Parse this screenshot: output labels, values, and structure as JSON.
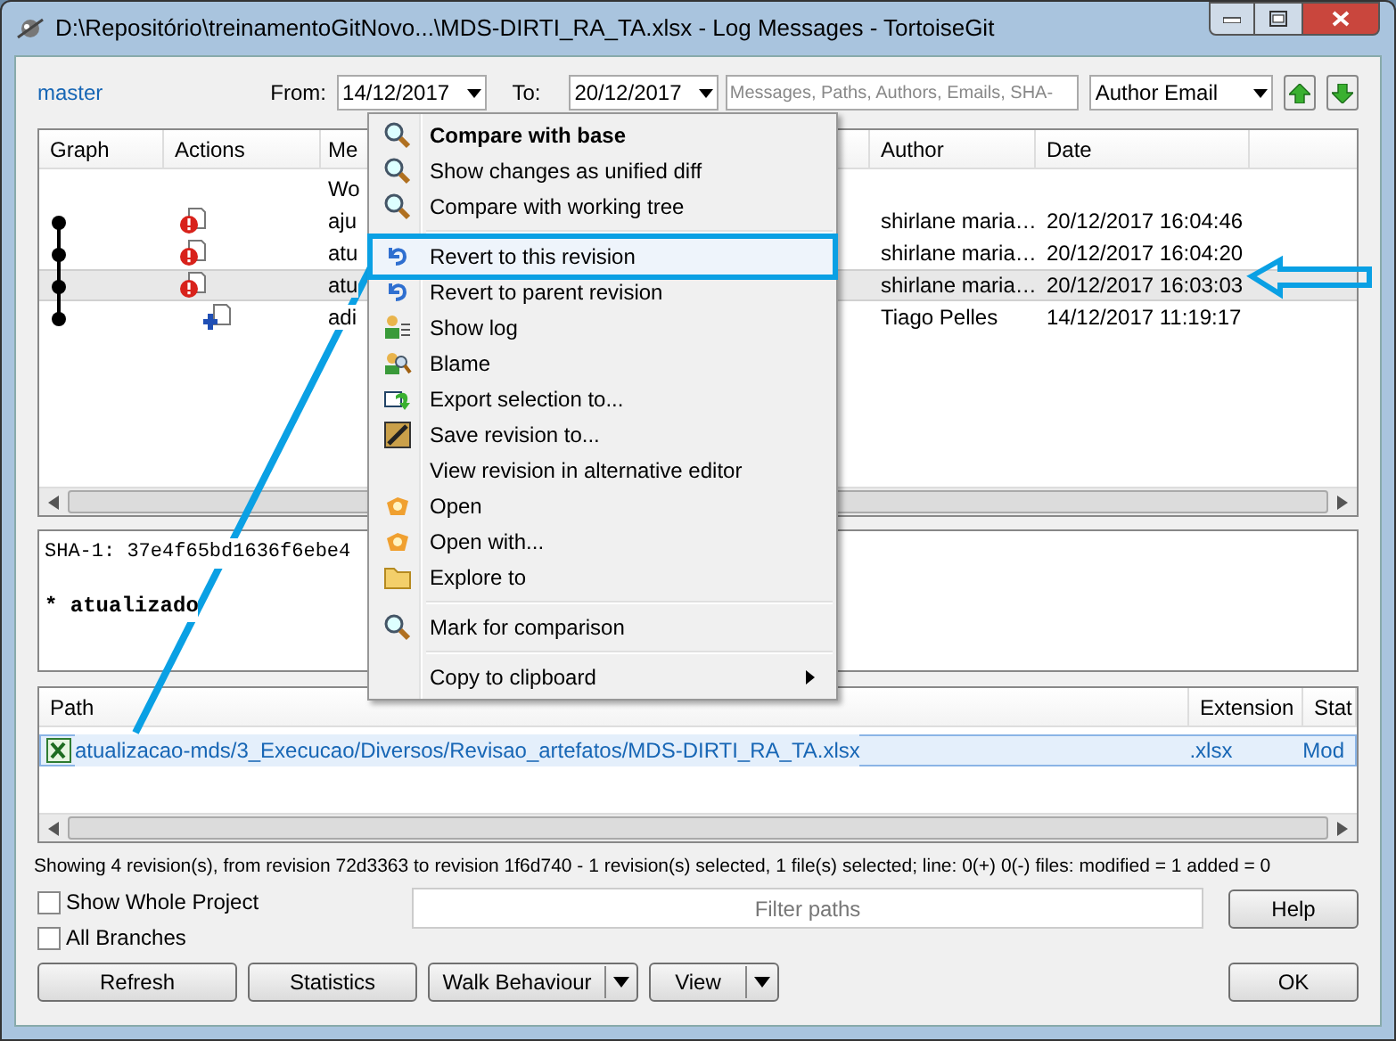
{
  "window": {
    "title": "D:\\Repositório\\treinamentoGitNovo...\\MDS-DIRTI_RA_TA.xlsx - Log Messages - TortoiseGit"
  },
  "toolbar": {
    "branch": "master",
    "from_label": "From:",
    "from_value": "14/12/2017",
    "to_label": "To:",
    "to_value": "20/12/2017",
    "search_placeholder": "Messages, Paths, Authors, Emails, SHA-",
    "filter_field": "Author Email"
  },
  "log": {
    "columns": [
      "Graph",
      "Actions",
      "Me",
      "Author",
      "Date"
    ],
    "rows": [
      {
        "kind": "working",
        "message": "Wo",
        "author": "",
        "date": "",
        "selected": false
      },
      {
        "kind": "modified",
        "message": "aju",
        "author": "shirlane maria…",
        "date": "20/12/2017 16:04:46",
        "selected": false
      },
      {
        "kind": "modified",
        "message": "atu",
        "author": "shirlane maria…",
        "date": "20/12/2017 16:04:20",
        "selected": false
      },
      {
        "kind": "modified",
        "message": "atu",
        "author": "shirlane maria…",
        "date": "20/12/2017 16:03:03",
        "selected": true
      },
      {
        "kind": "added",
        "message": "adi",
        "author": "Tiago Pelles",
        "date": "14/12/2017 11:19:17",
        "selected": false
      }
    ]
  },
  "message_pane": {
    "sha": "SHA-1: 37e4f65bd1636f6ebe4",
    "body": "* atualizado"
  },
  "files": {
    "columns": [
      "Path",
      "Extension",
      "Stat"
    ],
    "rows": [
      {
        "path": "atualizacao-mds/3_Execucao/Diversos/Revisao_artefatos/MDS-DIRTI_RA_TA.xlsx",
        "extension": ".xlsx",
        "status": "Mod",
        "selected": true
      }
    ]
  },
  "context_menu": [
    {
      "kind": "item",
      "label": "Compare with base",
      "bold": true,
      "selected": false
    },
    {
      "kind": "item",
      "label": "Show changes as unified diff",
      "bold": false,
      "selected": false
    },
    {
      "kind": "item",
      "label": "Compare with working tree",
      "bold": false,
      "selected": false
    },
    {
      "kind": "separator"
    },
    {
      "kind": "item",
      "label": "Revert to this revision",
      "bold": false,
      "selected": true
    },
    {
      "kind": "item",
      "label": "Revert to parent revision",
      "bold": false,
      "selected": false
    },
    {
      "kind": "item",
      "label": "Show log",
      "bold": false,
      "selected": false
    },
    {
      "kind": "item",
      "label": "Blame",
      "bold": false,
      "selected": false
    },
    {
      "kind": "item",
      "label": "Export selection to...",
      "bold": false,
      "selected": false
    },
    {
      "kind": "item",
      "label": "Save revision to...",
      "bold": false,
      "selected": false
    },
    {
      "kind": "item",
      "label": "View revision in alternative editor",
      "bold": false,
      "selected": false
    },
    {
      "kind": "item",
      "label": "Open",
      "bold": false,
      "selected": false
    },
    {
      "kind": "item",
      "label": "Open with...",
      "bold": false,
      "selected": false
    },
    {
      "kind": "item",
      "label": "Explore to",
      "bold": false,
      "selected": false
    },
    {
      "kind": "separator"
    },
    {
      "kind": "item",
      "label": "Mark for comparison",
      "bold": false,
      "selected": false
    },
    {
      "kind": "separator"
    },
    {
      "kind": "submenu",
      "label": "Copy to clipboard",
      "bold": false,
      "selected": false
    }
  ],
  "status_bar": "Showing 4 revision(s), from revision 72d3363 to revision 1f6d740 - 1 revision(s) selected, 1 file(s) selected; line: 0(+) 0(-) files: modified = 1 added = 0",
  "options": [
    {
      "label": "Show Whole Project",
      "checked": false
    },
    {
      "label": "All Branches",
      "checked": false
    }
  ],
  "filter_placeholder": "Filter paths",
  "buttons": [
    {
      "label": "Refresh",
      "kind": "plain"
    },
    {
      "label": "Statistics",
      "kind": "plain"
    },
    {
      "label": "Walk Behaviour",
      "kind": "split"
    },
    {
      "label": "View",
      "kind": "split"
    }
  ],
  "help_button": "Help",
  "ok_button": "OK"
}
